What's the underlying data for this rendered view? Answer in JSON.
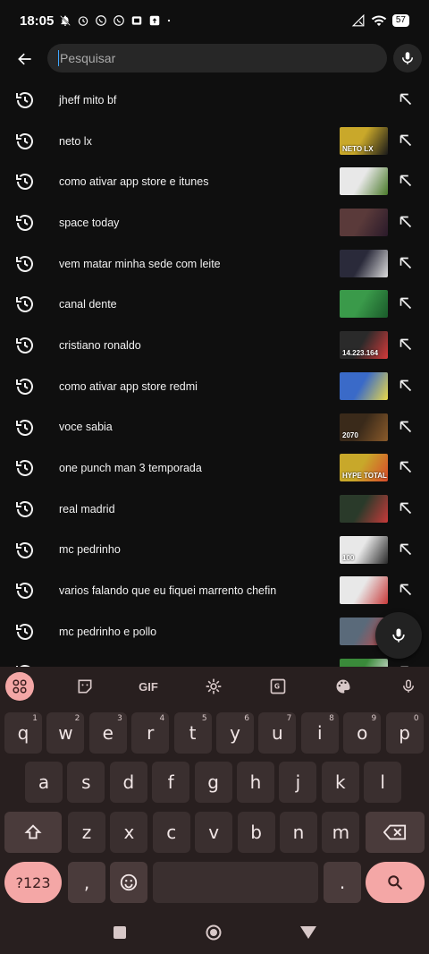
{
  "status_bar": {
    "time": "18:05",
    "battery": "57"
  },
  "search": {
    "placeholder": "Pesquisar",
    "value": ""
  },
  "suggestions": [
    {
      "label": "jheff mito bf",
      "thumb": false
    },
    {
      "label": "neto lx",
      "thumb": true,
      "thumb_colors": [
        "#c9a82a",
        "#1a1a1a"
      ],
      "thumb_text": "NETO LX"
    },
    {
      "label": "como ativar app store e itunes",
      "thumb": true,
      "thumb_colors": [
        "#e8e8e8",
        "#4a7a2a"
      ],
      "thumb_text": ""
    },
    {
      "label": "space today",
      "thumb": true,
      "thumb_colors": [
        "#5a3a3a",
        "#2a1a2a"
      ],
      "thumb_text": ""
    },
    {
      "label": "vem matar minha sede com leite",
      "thumb": true,
      "thumb_colors": [
        "#2a2a3a",
        "#dcdcdc"
      ],
      "thumb_text": ""
    },
    {
      "label": "canal dente",
      "thumb": true,
      "thumb_colors": [
        "#3a9a4a",
        "#1a5a2a"
      ],
      "thumb_text": ""
    },
    {
      "label": "cristiano ronaldo",
      "thumb": true,
      "thumb_colors": [
        "#2a2a2a",
        "#d43a3a"
      ],
      "thumb_text": "14.223.164"
    },
    {
      "label": "como ativar app store redmi",
      "thumb": true,
      "thumb_colors": [
        "#3a6ac8",
        "#e8d84a"
      ],
      "thumb_text": ""
    },
    {
      "label": "voce sabia",
      "thumb": true,
      "thumb_colors": [
        "#3a2a1a",
        "#8a5a2a"
      ],
      "thumb_text": "2070"
    },
    {
      "label": "one punch man 3 temporada",
      "thumb": true,
      "thumb_colors": [
        "#c8a82a",
        "#d84a2a"
      ],
      "thumb_text": "HYPE TOTAL"
    },
    {
      "label": "real madrid",
      "thumb": true,
      "thumb_colors": [
        "#2a3a2a",
        "#c83a3a"
      ],
      "thumb_text": ""
    },
    {
      "label": "mc pedrinho",
      "thumb": true,
      "thumb_colors": [
        "#e8e8e8",
        "#2a2a2a"
      ],
      "thumb_text": "100"
    },
    {
      "label": "varios falando que eu fiquei marrento chefin",
      "thumb": true,
      "thumb_colors": [
        "#e8e8e8",
        "#c83a3a"
      ],
      "thumb_text": ""
    },
    {
      "label": "mc pedrinho e pollo",
      "thumb": true,
      "thumb_colors": [
        "#5a6a7a",
        "#c84a4a"
      ],
      "thumb_text": ""
    },
    {
      "label": "",
      "thumb": true,
      "thumb_colors": [
        "#3a8a3a",
        "#e8e8e8"
      ],
      "thumb_text": ""
    }
  ],
  "keyboard": {
    "toolbar": {
      "gif": "GIF"
    },
    "row1": [
      [
        "q",
        "1"
      ],
      [
        "w",
        "2"
      ],
      [
        "e",
        "3"
      ],
      [
        "r",
        "4"
      ],
      [
        "t",
        "5"
      ],
      [
        "y",
        "6"
      ],
      [
        "u",
        "7"
      ],
      [
        "i",
        "8"
      ],
      [
        "o",
        "9"
      ],
      [
        "p",
        "0"
      ]
    ],
    "row2": [
      "a",
      "s",
      "d",
      "f",
      "g",
      "h",
      "j",
      "k",
      "l"
    ],
    "row3": [
      "z",
      "x",
      "c",
      "v",
      "b",
      "n",
      "m"
    ],
    "symbols_key": "?123",
    "comma_key": ",",
    "period_key": "."
  },
  "colors": {
    "accent": "#f4a7a6",
    "background": "#0f0f0f",
    "keyboard_bg": "#281f1f"
  }
}
